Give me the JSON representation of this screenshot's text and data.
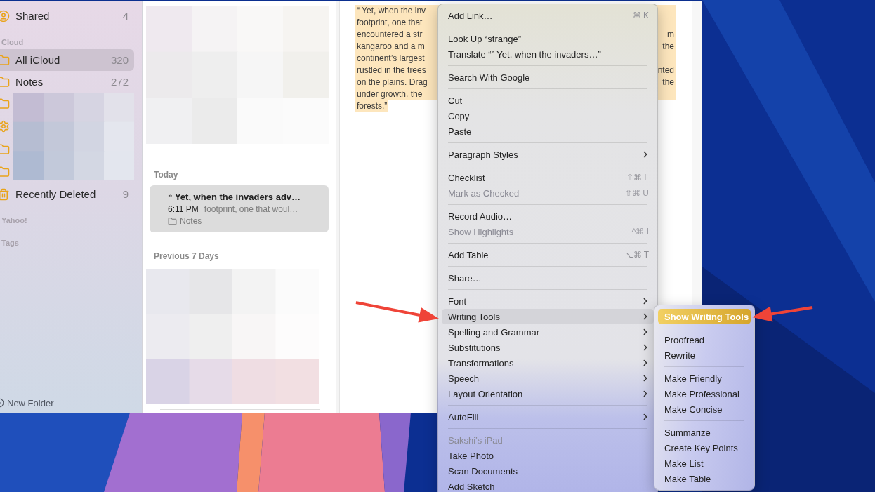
{
  "sidebar": {
    "entries": [
      {
        "kind": "shared",
        "label": "Shared",
        "count": "4",
        "selected": false
      },
      {
        "kind": "section",
        "label": "Cloud"
      },
      {
        "kind": "folder",
        "label": "All iCloud",
        "count": "320",
        "selected": true
      },
      {
        "kind": "folder",
        "label": "Notes",
        "count": "272",
        "selected": false
      },
      {
        "kind": "hidden"
      },
      {
        "kind": "trash",
        "label": "Recently Deleted",
        "count": "9",
        "selected": false
      },
      {
        "kind": "section",
        "label": "Yahoo!"
      },
      {
        "kind": "section",
        "label": "Tags"
      }
    ],
    "new_folder": "New Folder"
  },
  "note_list": {
    "groups": [
      {
        "header": "Today",
        "notes": [
          {
            "title": "“ Yet, when the invaders adv…",
            "time": "6:11 PM",
            "preview": "footprint, one that woul…",
            "folder": "Notes",
            "selected": true
          }
        ]
      },
      {
        "header": "Previous 7 Days"
      }
    ]
  },
  "editor": {
    "lines": [
      {
        "left": "“ Yet, when the inv"
      },
      {
        "left": "footprint, one that"
      },
      {
        "left": "encountered a str",
        "right": "m"
      },
      {
        "left": "kangaroo and a m",
        "right": "the"
      },
      {
        "left": "continent’s largest"
      },
      {
        "left": "rustled in the trees",
        "right": "nted"
      },
      {
        "left": "on the plains. Drag",
        "right": "the"
      },
      {
        "left": "under growth. the"
      },
      {
        "left": "forests.”"
      }
    ]
  },
  "context_menu": {
    "items": [
      {
        "kind": "item",
        "label": "Add Link…",
        "shortcut": "⌘ K",
        "disabled": false,
        "selected": false,
        "submenu": false
      },
      {
        "kind": "separator"
      },
      {
        "kind": "item",
        "label": "Look Up “strange”",
        "disabled": false,
        "selected": false,
        "submenu": false
      },
      {
        "kind": "item",
        "label": "Translate “” Yet, when the invaders…”",
        "disabled": false,
        "selected": false,
        "submenu": false
      },
      {
        "kind": "separator"
      },
      {
        "kind": "item",
        "label": "Search With Google",
        "disabled": false,
        "selected": false,
        "submenu": false
      },
      {
        "kind": "separator"
      },
      {
        "kind": "item",
        "label": "Cut",
        "disabled": false,
        "selected": false,
        "submenu": false
      },
      {
        "kind": "item",
        "label": "Copy",
        "disabled": false,
        "selected": false,
        "submenu": false
      },
      {
        "kind": "item",
        "label": "Paste",
        "disabled": false,
        "selected": false,
        "submenu": false
      },
      {
        "kind": "separator"
      },
      {
        "kind": "item",
        "label": "Paragraph Styles",
        "disabled": false,
        "selected": false,
        "submenu": true
      },
      {
        "kind": "separator"
      },
      {
        "kind": "item",
        "label": "Checklist",
        "shortcut": "⇧⌘ L",
        "disabled": false,
        "selected": false,
        "submenu": false
      },
      {
        "kind": "item",
        "label": "Mark as Checked",
        "shortcut": "⇧⌘ U",
        "disabled": true,
        "selected": false,
        "submenu": false
      },
      {
        "kind": "separator"
      },
      {
        "kind": "item",
        "label": "Record Audio…",
        "disabled": false,
        "selected": false,
        "submenu": false
      },
      {
        "kind": "item",
        "label": "Show Highlights",
        "shortcut": "^⌘ I",
        "disabled": true,
        "selected": false,
        "submenu": false
      },
      {
        "kind": "separator"
      },
      {
        "kind": "item",
        "label": "Add Table",
        "shortcut": "⌥⌘ T",
        "disabled": false,
        "selected": false,
        "submenu": false
      },
      {
        "kind": "separator"
      },
      {
        "kind": "item",
        "label": "Share…",
        "disabled": false,
        "selected": false,
        "submenu": false
      },
      {
        "kind": "separator"
      },
      {
        "kind": "item",
        "label": "Font",
        "disabled": false,
        "selected": false,
        "submenu": true
      },
      {
        "kind": "item",
        "label": "Writing Tools",
        "disabled": false,
        "selected": true,
        "submenu": true
      },
      {
        "kind": "item",
        "label": "Spelling and Grammar",
        "disabled": false,
        "selected": false,
        "submenu": true
      },
      {
        "kind": "item",
        "label": "Substitutions",
        "disabled": false,
        "selected": false,
        "submenu": true
      },
      {
        "kind": "item",
        "label": "Transformations",
        "disabled": false,
        "selected": false,
        "submenu": true
      },
      {
        "kind": "item",
        "label": "Speech",
        "disabled": false,
        "selected": false,
        "submenu": true
      },
      {
        "kind": "item",
        "label": "Layout Orientation",
        "disabled": false,
        "selected": false,
        "submenu": true
      },
      {
        "kind": "separator"
      },
      {
        "kind": "item",
        "label": "AutoFill",
        "disabled": false,
        "selected": false,
        "submenu": true
      },
      {
        "kind": "separator"
      },
      {
        "kind": "item",
        "label": "Sakshi’s iPad",
        "disabled": true,
        "selected": false,
        "submenu": false
      },
      {
        "kind": "item",
        "label": "Take Photo",
        "disabled": false,
        "selected": false,
        "submenu": false
      },
      {
        "kind": "item",
        "label": "Scan Documents",
        "disabled": false,
        "selected": false,
        "submenu": false
      },
      {
        "kind": "item",
        "label": "Add Sketch",
        "disabled": false,
        "selected": false,
        "submenu": false
      }
    ]
  },
  "writing_tools_menu": {
    "items": [
      {
        "kind": "item",
        "label": "Show Writing Tools",
        "selected": true
      },
      {
        "kind": "separator"
      },
      {
        "kind": "item",
        "label": "Proofread",
        "selected": false
      },
      {
        "kind": "item",
        "label": "Rewrite",
        "selected": false
      },
      {
        "kind": "separator"
      },
      {
        "kind": "item",
        "label": "Make Friendly",
        "selected": false
      },
      {
        "kind": "item",
        "label": "Make Professional",
        "selected": false
      },
      {
        "kind": "item",
        "label": "Make Concise",
        "selected": false
      },
      {
        "kind": "separator"
      },
      {
        "kind": "item",
        "label": "Summarize",
        "selected": false
      },
      {
        "kind": "item",
        "label": "Create Key Points",
        "selected": false
      },
      {
        "kind": "item",
        "label": "Make List",
        "selected": false
      },
      {
        "kind": "item",
        "label": "Make Table",
        "selected": false
      }
    ]
  }
}
